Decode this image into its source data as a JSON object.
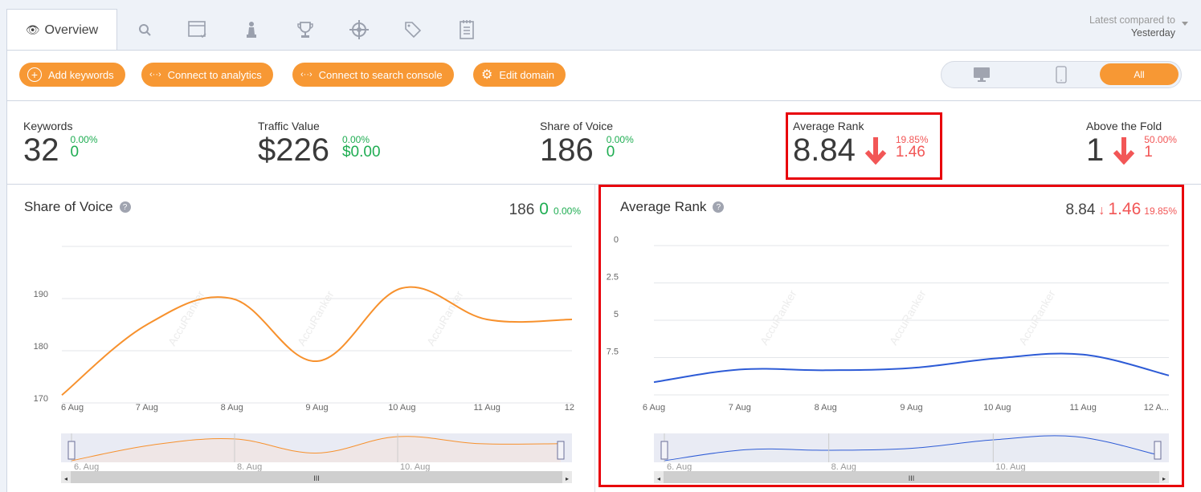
{
  "tabs": {
    "active_label": "Overview",
    "icons": [
      "search-icon",
      "browser-check-icon",
      "chess-pawn-icon",
      "trophy-icon",
      "crosshair-icon",
      "tags-icon",
      "notepad-icon"
    ]
  },
  "compare": {
    "label": "Latest compared to",
    "value": "Yesterday"
  },
  "toolbar": {
    "add_keywords": "Add keywords",
    "connect_analytics": "Connect to analytics",
    "connect_search_console": "Connect to search console",
    "edit_domain": "Edit domain"
  },
  "device_toggle": {
    "options": [
      "desktop-icon",
      "mobile-icon",
      "All"
    ],
    "selected": "All"
  },
  "kpis": {
    "keywords": {
      "label": "Keywords",
      "value": "32",
      "pct": "0.00%",
      "delta": "0"
    },
    "traffic_value": {
      "label": "Traffic Value",
      "value": "$226",
      "pct": "0.00%",
      "delta": "$0.00"
    },
    "share_of_voice": {
      "label": "Share of Voice",
      "value": "186",
      "pct": "0.00%",
      "delta": "0"
    },
    "average_rank": {
      "label": "Average Rank",
      "value": "8.84",
      "pct": "19.85%",
      "delta": "1.46",
      "trend": "down"
    },
    "above_the_fold": {
      "label": "Above the Fold",
      "value": "1",
      "pct": "50.00%",
      "delta": "1",
      "trend": "down"
    }
  },
  "colors": {
    "accent": "#f79834",
    "positive": "#1fad52",
    "negative": "#f25656",
    "series_sov": "#f7912d",
    "series_rank": "#2d5bd6"
  },
  "watermark": "AccuRanker",
  "chart_data": [
    {
      "type": "line",
      "title": "Share of Voice",
      "summary": {
        "value": "186",
        "delta": "0",
        "pct": "0.00%"
      },
      "categories": [
        "6 Aug",
        "7 Aug",
        "8 Aug",
        "9 Aug",
        "10 Aug",
        "11 Aug",
        "12"
      ],
      "values": [
        171.5,
        185,
        190,
        178,
        192,
        186,
        186
      ],
      "yticks": [
        "170",
        "180",
        "190"
      ],
      "ylim": [
        170,
        200
      ],
      "grid": true,
      "navigator_labels": [
        "6. Aug",
        "8. Aug",
        "10. Aug"
      ]
    },
    {
      "type": "line",
      "title": "Average Rank",
      "summary": {
        "value": "8.84",
        "delta": "1.46",
        "pct": "19.85%"
      },
      "categories": [
        "6 Aug",
        "7 Aug",
        "8 Aug",
        "9 Aug",
        "10 Aug",
        "11 Aug",
        "12 A..."
      ],
      "values": [
        9.15,
        8.3,
        8.35,
        8.2,
        7.55,
        7.3,
        8.7
      ],
      "yticks": [
        "0",
        "2.5",
        "5",
        "7.5"
      ],
      "ylim": [
        0,
        10
      ],
      "y_reversed": true,
      "grid": true,
      "navigator_labels": [
        "6. Aug",
        "8. Aug",
        "10. Aug"
      ]
    }
  ]
}
